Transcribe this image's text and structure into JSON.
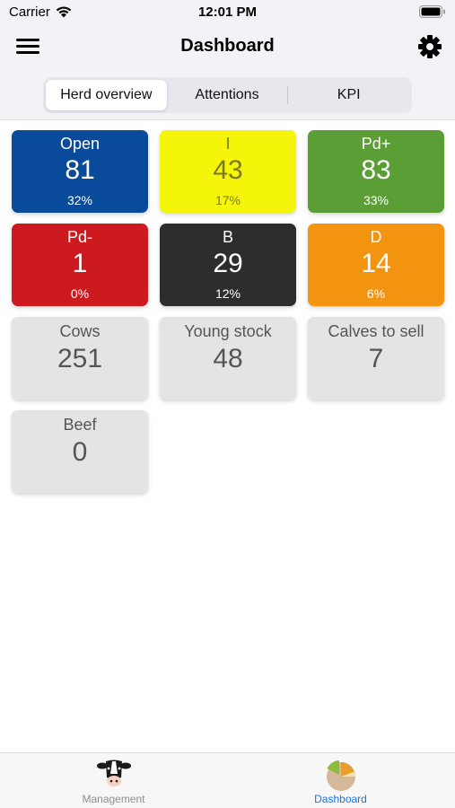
{
  "status": {
    "carrier": "Carrier",
    "time": "12:01 PM"
  },
  "nav": {
    "title": "Dashboard"
  },
  "segments": [
    {
      "label": "Herd overview",
      "active": true
    },
    {
      "label": "Attentions",
      "active": false
    },
    {
      "label": "KPI",
      "active": false
    }
  ],
  "tiles": [
    {
      "label": "Open",
      "value": "81",
      "pct": "32%",
      "bg": "#0a4a9a",
      "fg": "#ffffff"
    },
    {
      "label": "I",
      "value": "43",
      "pct": "17%",
      "bg": "#f5f50a",
      "fg": "#7a7a20"
    },
    {
      "label": "Pd+",
      "value": "83",
      "pct": "33%",
      "bg": "#5a9e35",
      "fg": "#ffffff"
    },
    {
      "label": "Pd-",
      "value": "1",
      "pct": "0%",
      "bg": "#cc1a1f",
      "fg": "#ffffff"
    },
    {
      "label": "B",
      "value": "29",
      "pct": "12%",
      "bg": "#2d2d2d",
      "fg": "#ffffff"
    },
    {
      "label": "D",
      "value": "14",
      "pct": "6%",
      "bg": "#f29410",
      "fg": "#ffffff"
    },
    {
      "label": "Cows",
      "value": "251"
    },
    {
      "label": "Young stock",
      "value": "48"
    },
    {
      "label": "Calves to sell",
      "value": "7"
    },
    {
      "label": "Beef",
      "value": "0"
    }
  ],
  "tabs": [
    {
      "label": "Management",
      "icon": "cow-icon",
      "color": "#8e8e93"
    },
    {
      "label": "Dashboard",
      "icon": "pie-chart-icon",
      "color": "#1a73e8"
    }
  ]
}
